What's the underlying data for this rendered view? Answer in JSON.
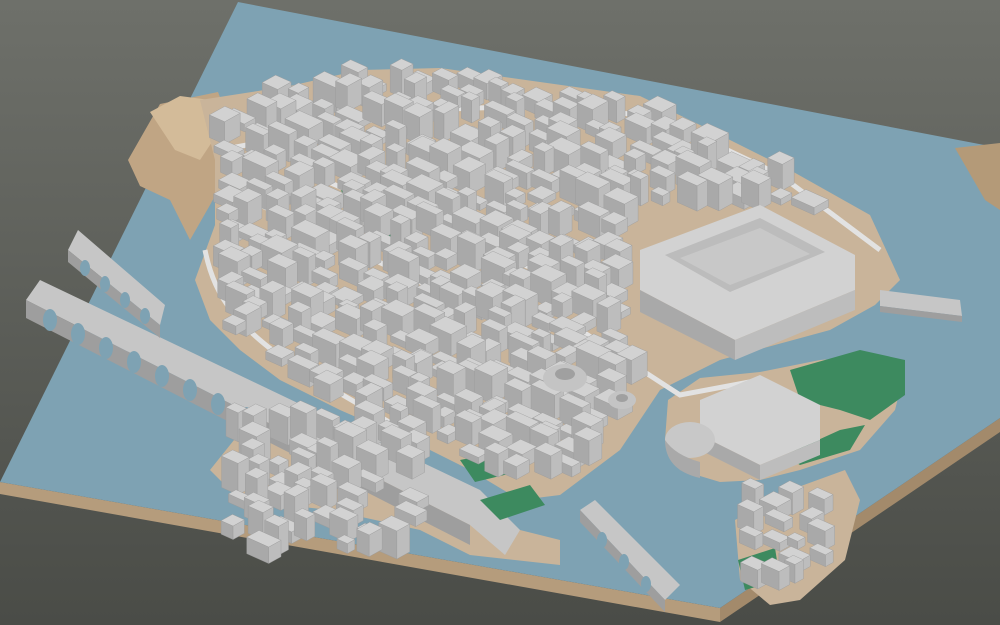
{
  "scene": {
    "kind": "3d-city-model-render",
    "palette": {
      "background_top": "#6e706a",
      "background_bottom": "#4a4c47",
      "water": "#7ea2b3",
      "ground": "#c9b49a",
      "slab_edge": "#b59c7c",
      "terrain": "#bda27f",
      "building_top": "#d2d2d2",
      "building_left": "#a9a9a9",
      "building_right": "#bdbdbd",
      "green_space": "#3d8a5f"
    }
  }
}
